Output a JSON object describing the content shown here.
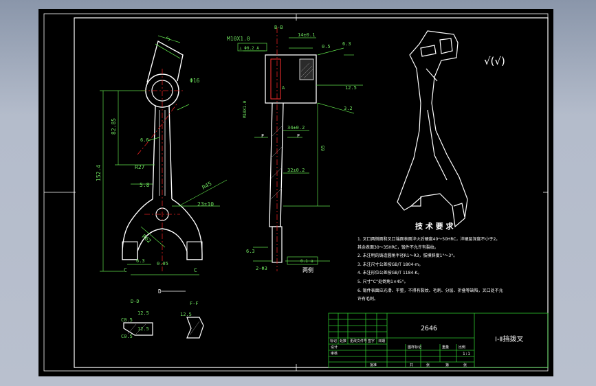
{
  "colors": {
    "background": "#000000",
    "frame": "#ffffff",
    "dimension": "#5fe04a",
    "centerline": "#e02020",
    "table_lines": "#2ec82e"
  },
  "front_view": {
    "top_callout": "5",
    "boss_dim": "Φ16",
    "left_length": "82.85",
    "total_length": "152.4",
    "radius_mid": "R27",
    "lower_dim": "5.8",
    "r45": "R45",
    "fork_dim": "23±10",
    "r62": "R62",
    "fork_bottom_label": "C",
    "fork_bottom_label_right": "C",
    "angle_note": "6.3",
    "flatness": "0.05",
    "d_mark": "D",
    "small_45": "6.6"
  },
  "section_view": {
    "title": "B-B",
    "thread": "M10X1.0",
    "tolerance_box": "⊥ Φ0.2 A",
    "top_dims": [
      "14±0.1",
      "0.5",
      "6.3"
    ],
    "side_mark": "M10X1.0",
    "mid_dims": [
      "34±0.2",
      "65",
      "32±0.2"
    ],
    "label_a": "A",
    "callout_f_left": "F",
    "callout_f_right": "F",
    "rough_1": "12.5",
    "rough_2": "3.2",
    "rough_3": "6.3",
    "bottom_dims": [
      "0.1",
      "a"
    ],
    "bottom_note": "两侧",
    "base_dim": "2-Φ3"
  },
  "detail_views": {
    "dd_title": "D-D",
    "ff_title": "F-F",
    "dd_dims": [
      "12.5",
      "C0.5",
      "C0.5",
      "12.5"
    ],
    "ff_dims": [
      "12.5"
    ]
  },
  "roughness_mark": "√(√)",
  "tech_requirements": {
    "title": "技 术 要 求",
    "items": [
      "1. 叉口两侧面和叉口端面表面淬火后硬度40～50HRC，淬硬层深度不小于2。",
      "其余表面30～35HRC，锻件不允许有裂纹。",
      "2. 未注明的铸造圆角半径R1～R3，拔模斜度1°～3°。",
      "3. 未注尺寸公差按GB/T 1804-m。",
      "4. 未注形位公差按GB/T 1184-K。",
      "5. 尺寸“C”处倒角1×45°。",
      "6. 锻件表面应光滑、平整，不得有裂纹、毛刺、分层、折叠等缺陷，叉口处不允",
      "许有毛刺。"
    ]
  },
  "title_block": {
    "drawing_no": "2646",
    "part_name": "Ⅰ-Ⅱ挡拨叉",
    "scale": "1:1",
    "small_labels": [
      "标记",
      "处数",
      "更改文件号",
      "签字",
      "日期"
    ],
    "row_labels": [
      "设计",
      "审核",
      "批准"
    ],
    "right_labels": [
      "图样标记",
      "重量",
      "比例"
    ],
    "bottom_labels": [
      "共",
      "张",
      "第",
      "张"
    ]
  }
}
